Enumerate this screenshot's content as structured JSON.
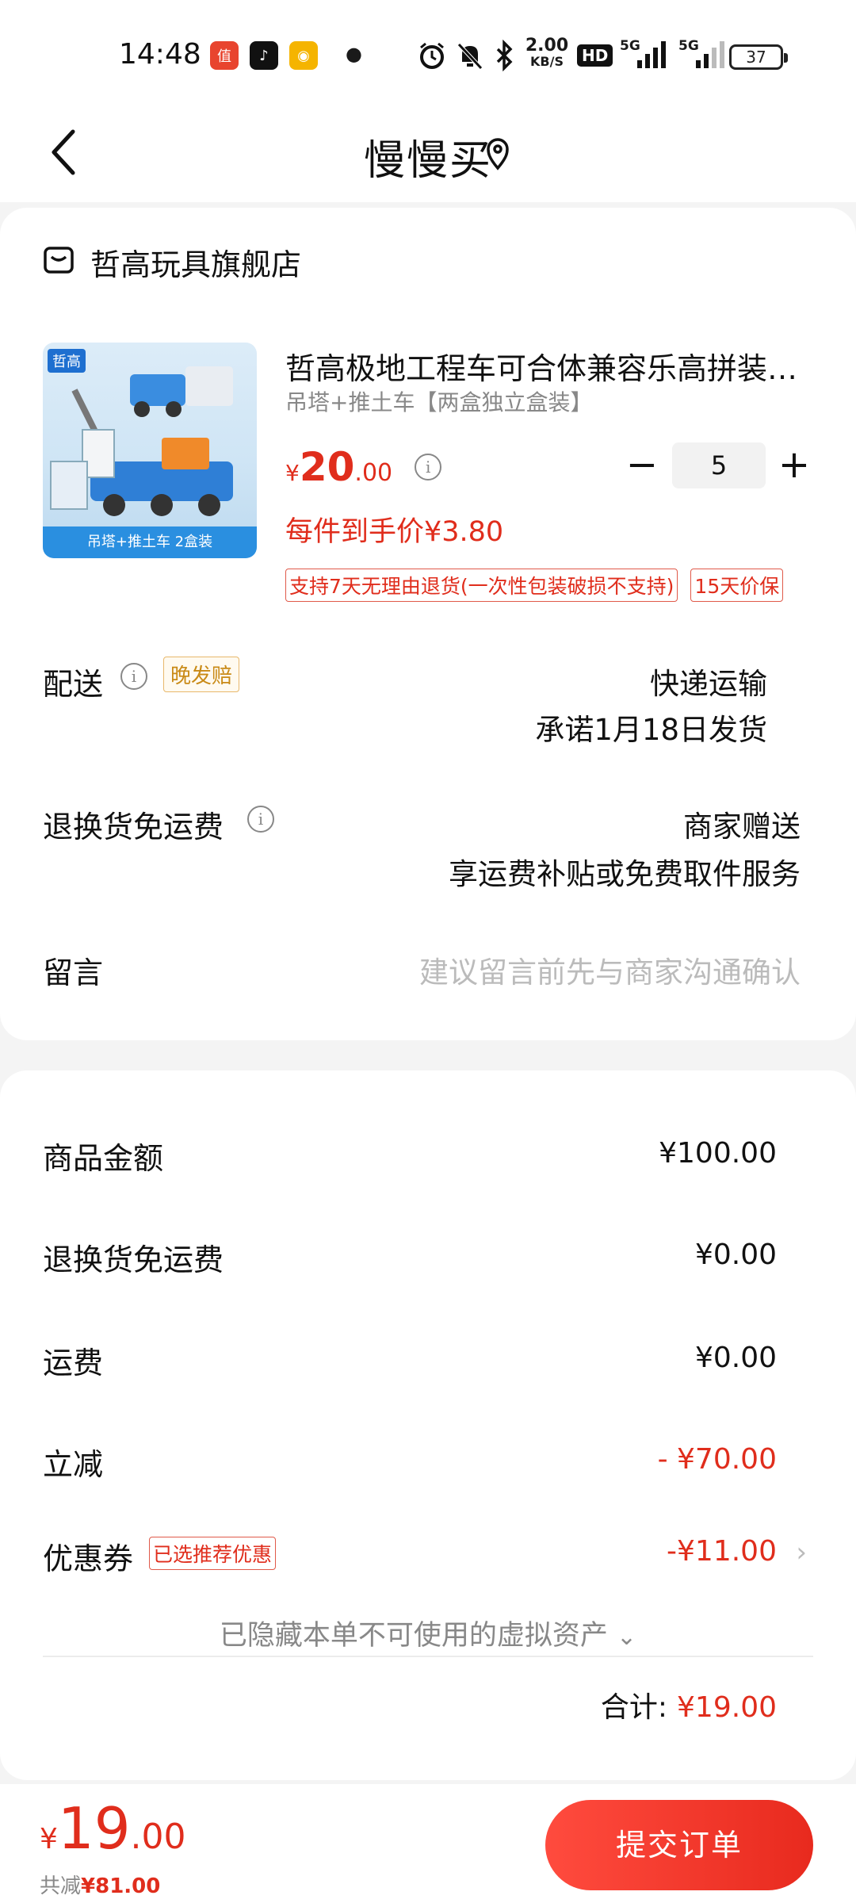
{
  "status_bar": {
    "time": "14:48",
    "net_speed_value": "2.00",
    "net_speed_unit": "KB/S",
    "hd_label": "HD",
    "signal_1": "5G",
    "signal_2": "5G",
    "battery": "37"
  },
  "header": {
    "title": "慢慢买"
  },
  "order": {
    "shop_name": "哲高玩具旗舰店",
    "thumbnail": {
      "brand": "哲高",
      "caption": "吊塔+推土车 2盒装"
    },
    "product_title": "哲高极地工程车可合体兼容乐高拼装…",
    "product_spec": "吊塔+推土车【两盒独立盒装】",
    "price_symbol": "¥",
    "price_int": "20",
    "price_dec": ".00",
    "quantity": "5",
    "unit_price_text": "每件到手价¥3.80",
    "tags": [
      "支持7天无理由退货(一次性包装破损不支持)",
      "15天价保"
    ],
    "delivery_label": "配送",
    "late_badge": "晚发赔",
    "delivery_method": "快递运输",
    "delivery_promise": "承诺1月18日发货",
    "return_label": "退换货免运费",
    "return_gift": "商家赠送",
    "return_desc": "享运费补贴或免费取件服务",
    "message_label": "留言",
    "message_placeholder": "建议留言前先与商家沟通确认"
  },
  "summary": {
    "goods_amount_label": "商品金额",
    "goods_amount": "¥100.00",
    "return_fee_label": "退换货免运费",
    "return_fee": "¥0.00",
    "shipping_label": "运费",
    "shipping": "¥0.00",
    "discount_label": "立减",
    "discount": "- ¥70.00",
    "coupon_label": "优惠券",
    "coupon_badge": "已选推荐优惠",
    "coupon": "-¥11.00",
    "hidden_assets": "已隐藏本单不可使用的虚拟资产",
    "total_label": "合计:",
    "total": "¥19.00"
  },
  "bottom_bar": {
    "symbol": "¥",
    "int": "19",
    "dec": ".00",
    "saved_label": "共减",
    "saved_value": "¥81.00",
    "submit_label": "提交订单"
  },
  "colors": {
    "accent_red": "#e02d1c",
    "badge_orange": "#c98a16",
    "background": "#f4f4f4"
  }
}
